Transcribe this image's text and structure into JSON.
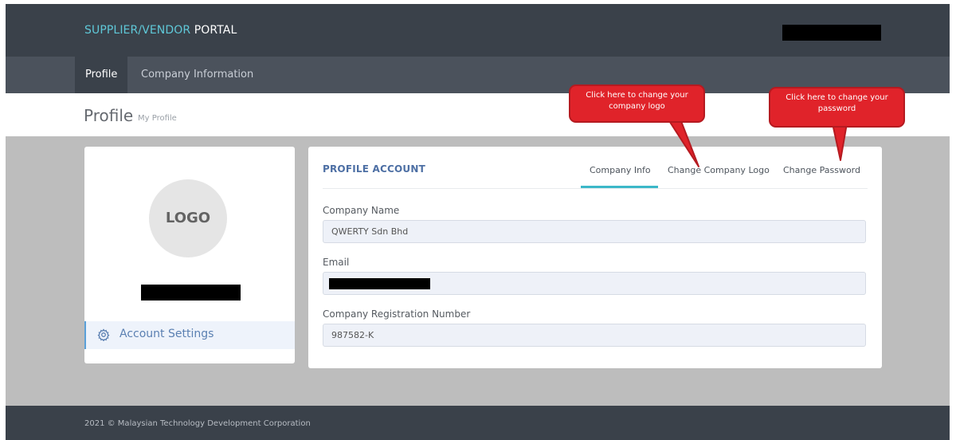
{
  "header": {
    "brand_accent": "SUPPLIER/VENDOR",
    "brand_strong": "PORTAL"
  },
  "nav": {
    "items": [
      {
        "label": "Profile",
        "active": true
      },
      {
        "label": "Company Information",
        "active": false
      }
    ]
  },
  "page": {
    "title": "Profile",
    "subtitle": "My Profile"
  },
  "left_card": {
    "logo_text": "LOGO",
    "account_settings_label": "Account Settings",
    "account_settings_icon": "gear-icon"
  },
  "profile_account": {
    "title": "PROFILE ACCOUNT",
    "tabs": [
      {
        "label": "Company Info",
        "active": true
      },
      {
        "label": "Change Company Logo",
        "active": false
      },
      {
        "label": "Change Password",
        "active": false
      }
    ],
    "fields": {
      "company_name": {
        "label": "Company Name",
        "value": "QWERTY Sdn Bhd"
      },
      "email": {
        "label": "Email",
        "value": ""
      },
      "registration": {
        "label": "Company Registration Number",
        "value": "987582-K"
      }
    }
  },
  "callouts": {
    "logo": "Click here to change your company logo",
    "password": "Click here to change your password"
  },
  "footer": {
    "text": "2021 © Malaysian Technology Development Corporation"
  },
  "colors": {
    "topbar": "#3a414a",
    "navbar": "#4b525c",
    "accent_teal": "#3cb8c8",
    "brand_teal": "#5fc8d8",
    "callout_red": "#e0232a",
    "link_blue": "#5b80b2"
  }
}
